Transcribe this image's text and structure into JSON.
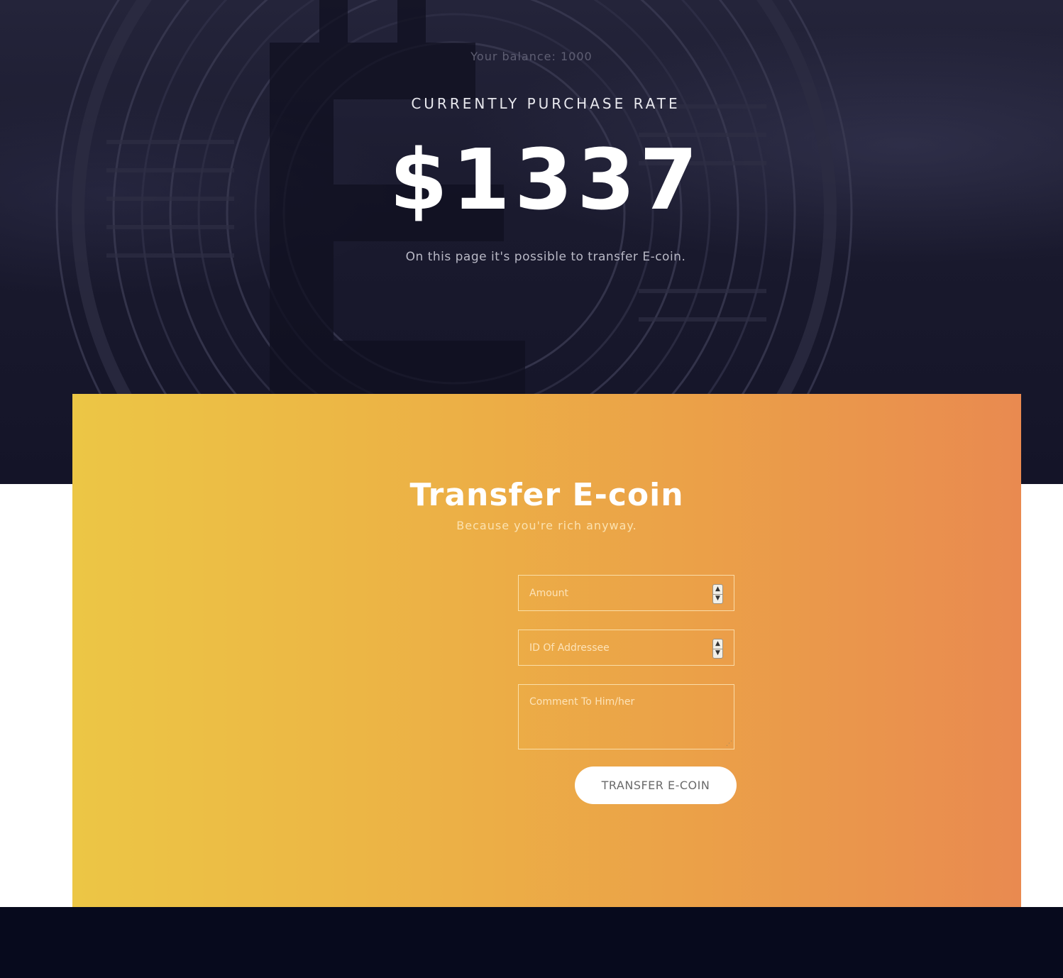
{
  "hero": {
    "balance_text": "Your balance: 1000",
    "rate_label": "CURRENTLY PURCHASE RATE",
    "rate_value": "$1337",
    "description": "On this page it's possible to transfer E-coin."
  },
  "transfer": {
    "title": "Transfer E-coin",
    "subtitle": "Because you're rich anyway.",
    "amount": {
      "value": "",
      "placeholder": "Amount"
    },
    "addressee": {
      "value": "",
      "placeholder": "ID Of Addressee"
    },
    "comment": {
      "value": "",
      "placeholder": "Comment To Him/her"
    },
    "submit_label": "TRANSFER E-COIN"
  },
  "colors": {
    "hero_bg": "#1a1a2e",
    "card_gradient_start": "#ecc645",
    "card_gradient_end": "#e98a50",
    "footer_bg": "#070a1d"
  },
  "icons": {
    "spinner_up": "▲",
    "spinner_down": "▼"
  }
}
